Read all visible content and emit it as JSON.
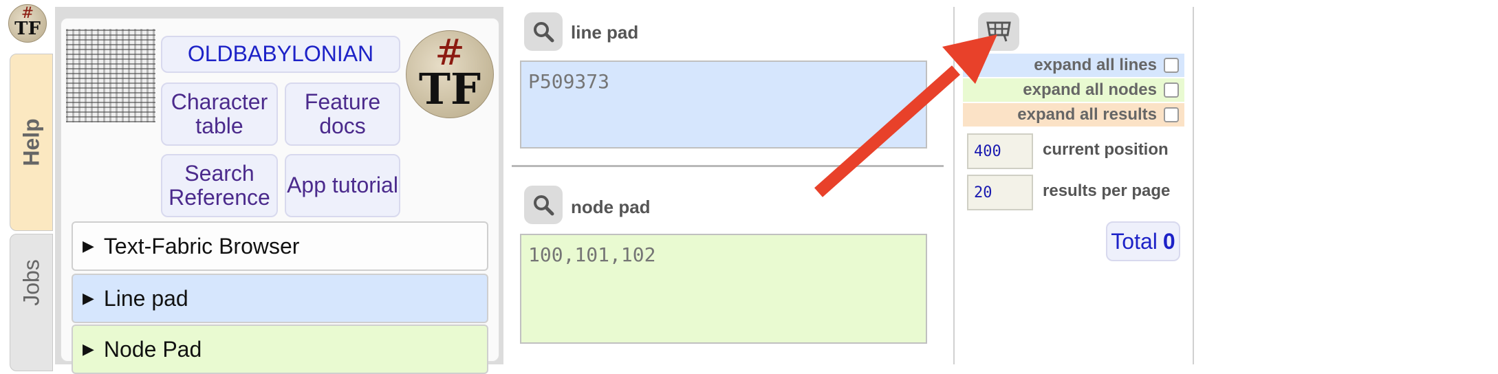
{
  "rail": {
    "logo_hash": "#",
    "logo_tf": "TF",
    "help_tab": "Help",
    "jobs_tab": "Jobs"
  },
  "panel": {
    "corpus_button": "OLDBABYLONIAN",
    "character_table": "Character table",
    "feature_docs": "Feature docs",
    "search_reference": "Search Reference",
    "app_tutorial": "App tutorial",
    "logo_hash": "#",
    "logo_tf": "TF",
    "sections": {
      "browser": "Text-Fabric Browser",
      "line_pad": "Line pad",
      "node_pad": "Node Pad"
    }
  },
  "pads": {
    "line_label": "line pad",
    "line_placeholder": "P509373",
    "node_label": "node pad",
    "node_placeholder": "100,101,102"
  },
  "options": {
    "expand_lines": "expand all lines",
    "expand_nodes": "expand all nodes",
    "expand_results": "expand all results",
    "position_value": "400",
    "position_label": "current position",
    "per_page_value": "20",
    "per_page_label": "results per page",
    "total_label": "Total",
    "total_value": "0"
  },
  "colors": {
    "line_bg": "#d6e6fd",
    "node_bg": "#e9fad1",
    "results_bg": "#fbe2c6",
    "arrow": "#e8412a"
  },
  "icons": [
    "search-icon",
    "grid-icon",
    "disclosure-triangle-icon"
  ]
}
